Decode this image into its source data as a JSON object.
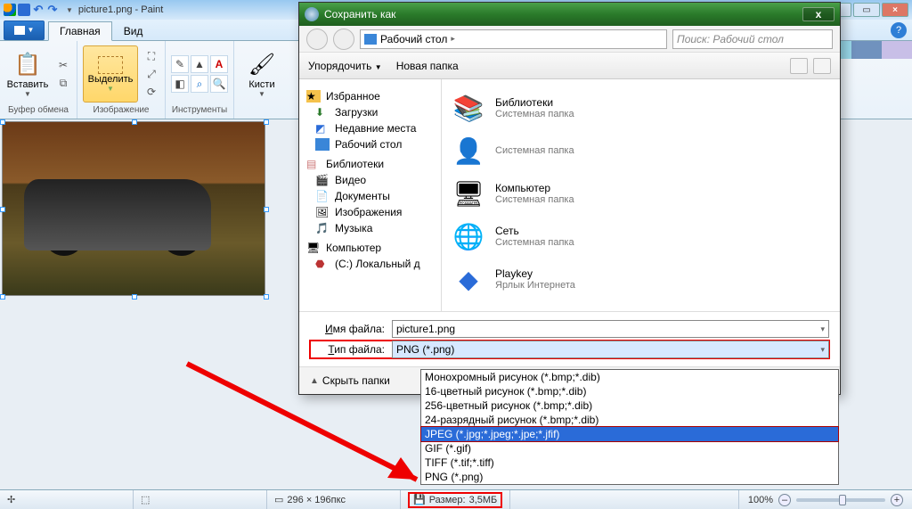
{
  "window": {
    "title": "picture1.png - Paint"
  },
  "tabs": {
    "home": "Главная",
    "view": "Вид"
  },
  "ribbon": {
    "clipboard": {
      "paste": "Вставить",
      "label": "Буфер обмена"
    },
    "image": {
      "select": "Выделить",
      "label": "Изображение"
    },
    "tools": {
      "label": "Инструменты"
    },
    "brushes": {
      "btn": "Кисти"
    }
  },
  "status": {
    "dims": "296 × 196пкс",
    "size_label": "Размер:",
    "size_value": "3,5МБ",
    "zoom": "100%"
  },
  "dialog": {
    "title": "Сохранить как",
    "breadcrumb": "Рабочий стол",
    "search_placeholder": "Поиск: Рабочий стол",
    "organize": "Упорядочить",
    "newfolder": "Новая папка",
    "tree": {
      "favorites": "Избранное",
      "downloads": "Загрузки",
      "recent": "Недавние места",
      "desktop": "Рабочий стол",
      "libraries": "Библиотеки",
      "video": "Видео",
      "documents": "Документы",
      "images": "Изображения",
      "music": "Музыка",
      "computer": "Компьютер",
      "drive_c": "(C:) Локальный д"
    },
    "items": [
      {
        "name": "Библиотеки",
        "sub": "Системная папка"
      },
      {
        "name": "",
        "sub": "Системная папка"
      },
      {
        "name": "Компьютер",
        "sub": "Системная папка"
      },
      {
        "name": "Сеть",
        "sub": "Системная папка"
      },
      {
        "name": "Playkey",
        "sub": "Ярлык Интернета"
      }
    ],
    "filename_label": "Имя файла:",
    "filetype_label": "Тип файла:",
    "filename_value": "picture1.png",
    "filetype_value": "PNG (*.png)",
    "hide_folders": "Скрыть папки",
    "type_options": [
      "Монохромный рисунок (*.bmp;*.dib)",
      "16-цветный рисунок (*.bmp;*.dib)",
      "256-цветный рисунок (*.bmp;*.dib)",
      "24-разрядный рисунок (*.bmp;*.dib)",
      "JPEG (*.jpg;*.jpeg;*.jpe;*.jfif)",
      "GIF (*.gif)",
      "TIFF (*.tif;*.tiff)",
      "PNG (*.png)"
    ]
  },
  "palette_colors": [
    "#000",
    "#7f7f7f",
    "#880015",
    "#ed1c24",
    "#ff7f27",
    "#fff200",
    "#22b14c",
    "#00a2e8",
    "#3f48cc",
    "#a349a4",
    "#fff",
    "#c3c3c3",
    "#b97a57",
    "#ffaec9",
    "#ffc90e",
    "#efe4b0",
    "#b5e61d",
    "#99d9ea",
    "#7092be",
    "#c8bfe7"
  ]
}
